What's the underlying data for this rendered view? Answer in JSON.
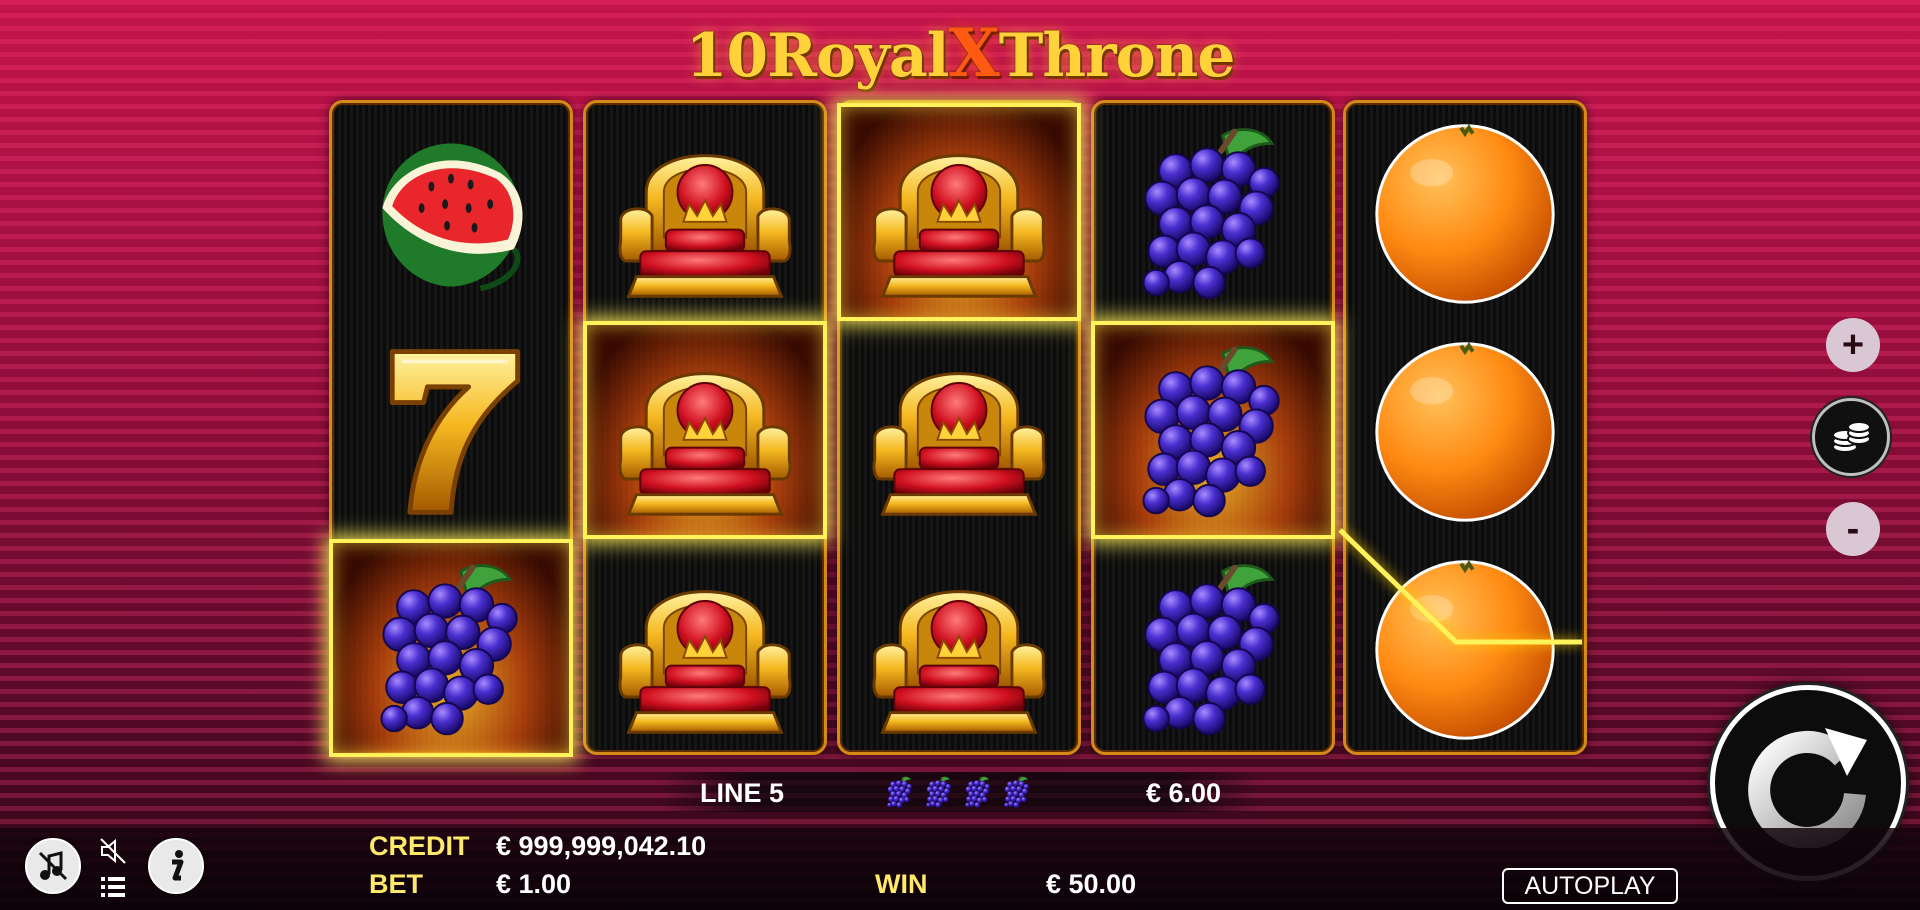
{
  "game": {
    "title_number": "10",
    "title_word1": "Royal",
    "title_x": "X",
    "title_word2": "Throne"
  },
  "reels": [
    [
      "watermelon",
      "seven",
      "grapes"
    ],
    [
      "throne",
      "throne",
      "throne"
    ],
    [
      "throne",
      "throne",
      "throne"
    ],
    [
      "grapes",
      "grapes",
      "grapes"
    ],
    [
      "orange",
      "orange",
      "orange"
    ]
  ],
  "winning_cells": [
    [
      0,
      2
    ],
    [
      1,
      1
    ],
    [
      2,
      0
    ],
    [
      3,
      1
    ]
  ],
  "line_info": {
    "label": "LINE 5",
    "symbol": "grapes-icon",
    "symbol_count": 4,
    "amount": "€ 6.00"
  },
  "stats": {
    "credit_label": "CREDIT",
    "credit_value": "€ 999,999,042.10",
    "bet_label": "BET",
    "bet_value": "€ 1.00",
    "win_label": "WIN",
    "win_value": "€ 50.00"
  },
  "controls": {
    "autoplay_label": "AUTOPLAY",
    "plus_label": "+",
    "minus_label": "-"
  },
  "colors": {
    "accent": "#ffe96a",
    "reel_border": "#d58a18",
    "win_highlight": "#fff25a"
  }
}
